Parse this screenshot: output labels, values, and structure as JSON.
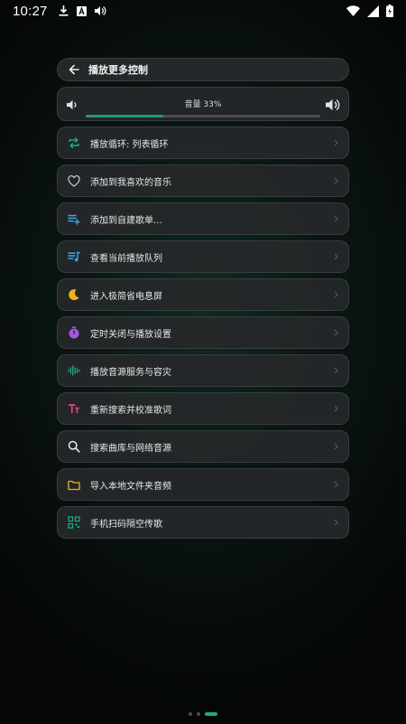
{
  "status_bar": {
    "time": "10:27",
    "left_icons": [
      "download-icon",
      "font-box-icon",
      "volume-icon"
    ],
    "right_icons": [
      "wifi-icon",
      "signal-icon",
      "battery-icon"
    ]
  },
  "header": {
    "back_icon": "arrow-left-icon",
    "title": "播放更多控制"
  },
  "volume": {
    "label": "音量 33%",
    "level_percent": 33,
    "accent_color": "#1f9a7c"
  },
  "menu": {
    "items": [
      {
        "key": "repeat",
        "icon": "repeat-icon",
        "color": "#1fae88",
        "label": "播放循环: 列表循环"
      },
      {
        "key": "favorite",
        "icon": "heart-icon",
        "color": "#c9cccb",
        "label": "添加到我喜欢的音乐"
      },
      {
        "key": "add-playlist",
        "icon": "playlist-add-icon",
        "color": "#3aa8e8",
        "label": "添加到自建歌单..."
      },
      {
        "key": "queue",
        "icon": "queue-music-icon",
        "color": "#3aa8e8",
        "label": "查看当前播放队列"
      },
      {
        "key": "power-save",
        "icon": "moon-icon",
        "color": "#f0b21c",
        "label": "进入极简省电息屏"
      },
      {
        "key": "timer",
        "icon": "timer-icon",
        "color": "#a257e0",
        "label": "定时关闭与播放设置"
      },
      {
        "key": "source",
        "icon": "soundwave-icon",
        "color": "#1fae88",
        "label": "播放音源服务与容灾"
      },
      {
        "key": "lyrics",
        "icon": "text-size-icon",
        "color": "#e2467a",
        "label": "重新搜索并校准歌词"
      },
      {
        "key": "search",
        "icon": "search-icon",
        "color": "#e9ecea",
        "label": "搜索曲库与网络音源"
      },
      {
        "key": "import",
        "icon": "folder-icon",
        "color": "#f0b21c",
        "label": "导入本地文件夹音频"
      },
      {
        "key": "scan",
        "icon": "qr-scan-icon",
        "color": "#1fae88",
        "label": "手机扫码隔空传歌"
      }
    ]
  },
  "pager": {
    "count": 3,
    "active_index": 2,
    "accent_color": "#1fa883"
  }
}
